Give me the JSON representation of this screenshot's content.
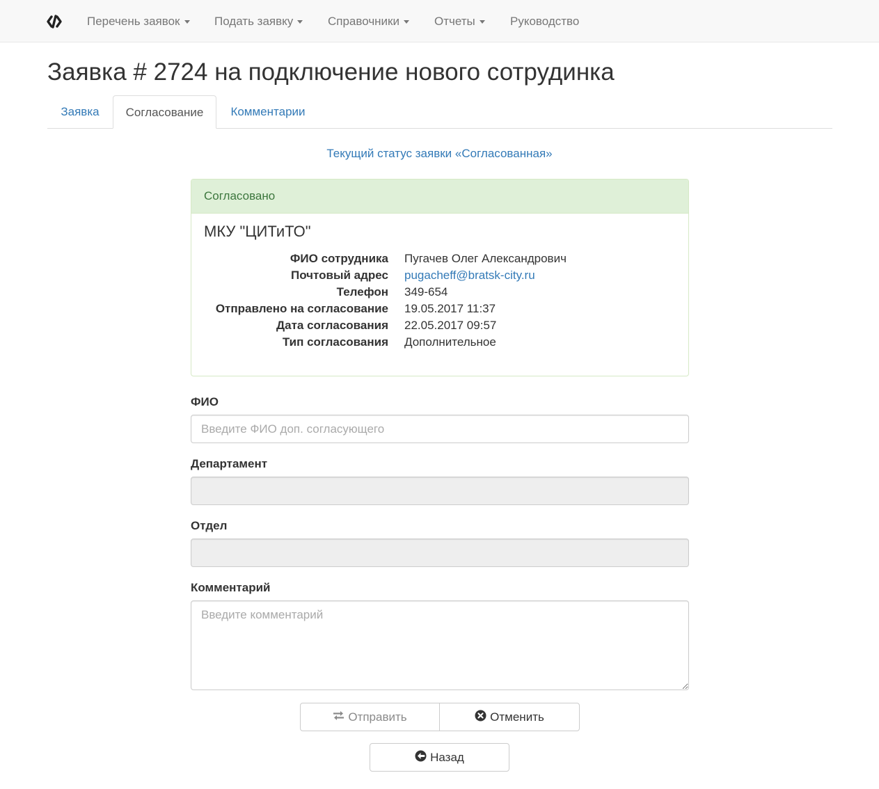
{
  "navbar": {
    "brand_icon": "code-slash-icon",
    "items": [
      {
        "label": "Перечень заявок",
        "dropdown": true
      },
      {
        "label": "Подать заявку",
        "dropdown": true
      },
      {
        "label": "Справочники",
        "dropdown": true
      },
      {
        "label": "Отчеты",
        "dropdown": true
      },
      {
        "label": "Руководство",
        "dropdown": false
      }
    ]
  },
  "page": {
    "title": "Заявка # 2724 на подключение нового сотрудинка"
  },
  "tabs": [
    {
      "label": "Заявка",
      "active": false
    },
    {
      "label": "Согласование",
      "active": true
    },
    {
      "label": "Комментарии",
      "active": false
    }
  ],
  "status_text": "Текущий статус заявки «Согласованная»",
  "approval_panel": {
    "heading": "Согласовано",
    "organization": "МКУ \"ЦИТиТО\"",
    "details": [
      {
        "term": "ФИО сотрудника",
        "value": "Пугачев Олег Александрович"
      },
      {
        "term": "Почтовый адрес",
        "value": "pugacheff@bratsk-city.ru"
      },
      {
        "term": "Телефон",
        "value": "349-654"
      },
      {
        "term": "Отправлено на согласование",
        "value": "19.05.2017 11:37"
      },
      {
        "term": "Дата согласования",
        "value": "22.05.2017 09:57"
      },
      {
        "term": "Тип согласования",
        "value": "Дополнительное"
      }
    ]
  },
  "form": {
    "fio": {
      "label": "ФИО",
      "placeholder": "Введите ФИО доп. согласующего",
      "value": ""
    },
    "department": {
      "label": "Департамент",
      "value": ""
    },
    "division": {
      "label": "Отдел",
      "value": ""
    },
    "comment": {
      "label": "Комментарий",
      "placeholder": "Введите комментарий",
      "value": ""
    }
  },
  "buttons": {
    "send": {
      "label": "Отправить",
      "icon": "transfer-icon",
      "disabled": true
    },
    "cancel": {
      "label": "Отменить",
      "icon": "remove-circle-icon"
    },
    "back": {
      "label": "Назад",
      "icon": "circle-arrow-left-icon"
    }
  },
  "colors": {
    "link": "#337ab7",
    "success_bg": "#dff0d8",
    "success_border": "#d6e9c6",
    "success_text": "#3c763d",
    "navbar_bg": "#f8f8f8",
    "disabled_input_bg": "#eeeeee"
  }
}
